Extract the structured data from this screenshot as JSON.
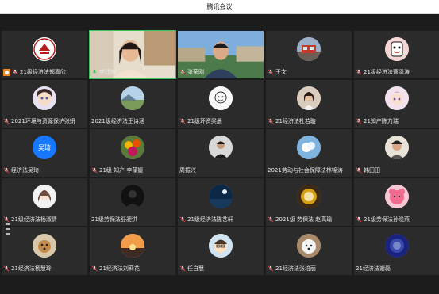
{
  "window": {
    "title": "腾讯会议"
  },
  "participants": [
    {
      "name": "21级经济法郑嘉欣",
      "avatar": "university-logo",
      "host": true
    },
    {
      "name": "李建梅",
      "avatar": "video-woman",
      "video": true
    },
    {
      "name": "张荣刚",
      "avatar": "video-man",
      "video": true
    },
    {
      "name": "王文",
      "avatar": "bus-photo"
    },
    {
      "name": "21级经济法曹泽涛",
      "avatar": "cartoon-face"
    },
    {
      "name": "2021环境与资源保护张妍",
      "avatar": "anime-girl"
    },
    {
      "name": "2021级经济法王诗涵",
      "avatar": "landscape-photo",
      "no_mic": true
    },
    {
      "name": "21级环资梁晨",
      "avatar": "sketch-face"
    },
    {
      "name": "21经济法杜若璇",
      "avatar": "girl-photo"
    },
    {
      "name": "21知产陈力瑞",
      "avatar": "anime-pink"
    },
    {
      "name": "经济法吴琦",
      "avatar": "text",
      "avatar_text": "吴琦"
    },
    {
      "name": "21级 知产 李蒲媛",
      "avatar": "flowers-photo"
    },
    {
      "name": "周振兴",
      "avatar": "man-dark",
      "no_mic": true
    },
    {
      "name": "2021劳动与社会保障法林锦涛",
      "avatar": "sky-photo",
      "no_mic": true
    },
    {
      "name": "韩田田",
      "avatar": "man-portrait"
    },
    {
      "name": "21级经济法杨淑倩",
      "avatar": "girl-sketch"
    },
    {
      "name": "21级劳保法舒昶洪",
      "avatar": "dark-figure",
      "no_mic": true
    },
    {
      "name": "21级经济法陈艺轩",
      "avatar": "night-sea"
    },
    {
      "name": "2021级 劳保法 赵高瑜",
      "avatar": "golden-icon"
    },
    {
      "name": "21级劳保法孙晓燕",
      "avatar": "pink-bear"
    },
    {
      "name": "21经济法杨慧玲",
      "avatar": "dog-photo"
    },
    {
      "name": "21经济法刘莉花",
      "avatar": "sunset-photo"
    },
    {
      "name": "任自慧",
      "avatar": "cartoon-boy"
    },
    {
      "name": "21经济法张培丽",
      "avatar": "white-dog"
    },
    {
      "name": "21经济法谢磊",
      "avatar": "blue-abstract",
      "no_mic": true
    }
  ],
  "colors": {
    "background": "#1c1c1c",
    "tile": "#2b2b2b",
    "host_badge": "#f08a24",
    "mic_muted": "#e53935",
    "mic_active": "#34c759",
    "text_avatar": "#1677ff"
  }
}
